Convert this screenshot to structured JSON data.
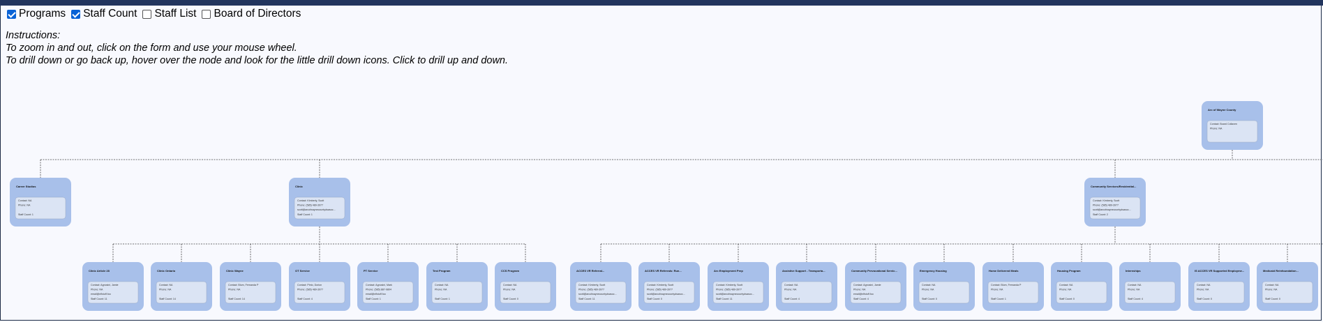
{
  "controls": {
    "checkboxes": [
      {
        "label": "Programs",
        "checked": true
      },
      {
        "label": "Staff Count",
        "checked": true
      },
      {
        "label": "Staff List",
        "checked": false
      },
      {
        "label": "Board of Directors",
        "checked": false
      }
    ]
  },
  "instructions": {
    "heading": "Instructions:",
    "line1": "To zoom in and out, click on the form and use your mouse wheel.",
    "line2": "To drill down or go back up, hover over the node and look for the little drill down icons. Click to drill up and down."
  },
  "colors": {
    "node_fill": "#a8c0ea",
    "inner_fill": "#dbe4f4",
    "connector": "#444444"
  },
  "chart_data": {
    "type": "org-chart",
    "root": {
      "id": "root",
      "title": "Arc of Wayne County",
      "lines": [
        "Contact: Board Collaven",
        "Phone: NA"
      ]
    },
    "level1": [
      {
        "id": "cs",
        "title": "Career Studios",
        "lines": [
          "Contact: NA",
          "Phone: NA",
          "",
          "Staff Count: 1"
        ]
      },
      {
        "id": "clinic",
        "title": "Clinic",
        "lines": [
          "Contact: Kimberly, Scott",
          "Phone: (585) 489-3977",
          "scott@arcofwaynecountydsasoc...",
          "Staff Count: 1"
        ]
      },
      {
        "id": "comm",
        "title": "Community Services/Residential...",
        "lines": [
          "Contact: Kimberly, Scott",
          "Phone: (585) 489-3977",
          "scott@arcofwaynecountydsasoc...",
          "Staff Count: 2"
        ]
      }
    ],
    "level2": [
      {
        "parent": "clinic",
        "title": "Clinic Article 28",
        "lines": [
          "Contact: Agnosini, Jamie",
          "Phone: NA",
          "email@nflstuff.foo",
          "Staff Count: 11"
        ]
      },
      {
        "parent": "clinic",
        "title": "Clinic Ontario",
        "lines": [
          "Contact: NA",
          "Phone: NA",
          "",
          "Staff Count: 14"
        ]
      },
      {
        "parent": "clinic",
        "title": "Clinic Wayne",
        "lines": [
          "Contact: Blum, Fernanda P",
          "Phone: NA",
          "",
          "Staff Count: 14"
        ]
      },
      {
        "parent": "clinic",
        "title": "OT Service",
        "lines": [
          "Contact: Pinto, Dorion",
          "Phone: (585) 489-3977",
          "",
          "Staff Count: 4"
        ]
      },
      {
        "parent": "clinic",
        "title": "PT Service",
        "lines": [
          "Contact: Agnosini, Mark",
          "Phone: (585) 887-9804",
          "email@nflstuff.foo",
          "Staff Count: 1"
        ]
      },
      {
        "parent": "clinic",
        "title": "Test Program",
        "lines": [
          "Contact: NA",
          "Phone: NA",
          "",
          "Staff Count: 1"
        ]
      },
      {
        "parent": "clinic",
        "title": "CCS Program",
        "lines": [
          "Contact: NA",
          "Phone: NA",
          "",
          "Staff Count: 0"
        ]
      },
      {
        "parent": "comm",
        "title": "ACCES VR Referral...",
        "lines": [
          "Contact: Kimberly, Scott",
          "Phone: (585) 489-3977",
          "scott@arcofwaynecountydsasoc...",
          "Staff Count: 11"
        ]
      },
      {
        "parent": "comm",
        "title": "ACCES VR Referrals: Run...",
        "lines": [
          "Contact: Kimberly, Scott",
          "Phone: (585) 489-3977",
          "scott@arcofwaynecountydsasoc...",
          "Staff Count: 0"
        ]
      },
      {
        "parent": "comm",
        "title": "Arc Employment Prep",
        "lines": [
          "Contact: Kimberly, Scott",
          "Phone: (585) 489-3977",
          "scott@arcofwaynecountydsasoc...",
          "Staff Count: 11"
        ]
      },
      {
        "parent": "comm",
        "title": "Assistive Support - Transporta...",
        "lines": [
          "Contact: NA",
          "Phone: NA",
          "",
          "Staff Count: 4"
        ]
      },
      {
        "parent": "comm",
        "title": "Community Prevocational Servic...",
        "lines": [
          "Contact: Agnosini, Jamie",
          "Phone: NA",
          "email@nflstuff.foo",
          "Staff Count: 4"
        ]
      },
      {
        "parent": "comm",
        "title": "Emergency Housing",
        "lines": [
          "Contact: NA",
          "Phone: NA",
          "",
          "Staff Count: 0"
        ]
      },
      {
        "parent": "comm",
        "title": "Home Delivered Meals",
        "lines": [
          "Contact: Blum, Fernanda P",
          "Phone: NA",
          "",
          "Staff Count: 1"
        ]
      },
      {
        "parent": "comm",
        "title": "Housing Program",
        "lines": [
          "Contact: NA",
          "Phone: NA",
          "",
          "Staff Count: 0"
        ]
      },
      {
        "parent": "comm",
        "title": "Internships",
        "lines": [
          "Contact: NA",
          "Phone: NA",
          "",
          "Staff Count: 4"
        ]
      },
      {
        "parent": "comm",
        "title": "IS ACCES VR Supported Employme...",
        "lines": [
          "Contact: NA",
          "Phone: NA",
          "",
          "Staff Count: 0"
        ]
      },
      {
        "parent": "comm",
        "title": "Medicaid Reinfoundation...",
        "lines": [
          "Contact: NA",
          "Phone: NA",
          "",
          "Staff Count: 0"
        ]
      }
    ]
  }
}
